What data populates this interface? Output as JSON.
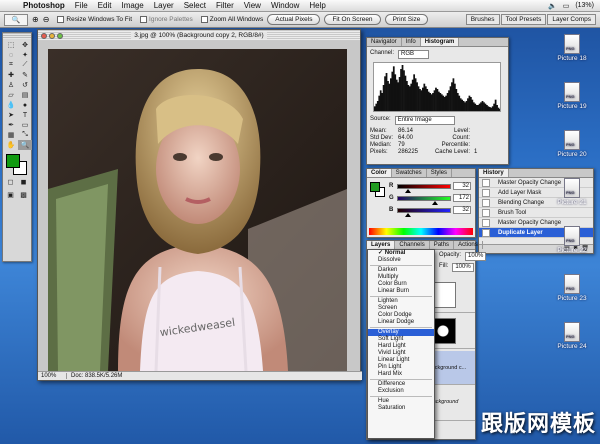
{
  "menubar": {
    "app": "Photoshop",
    "menus": [
      "File",
      "Edit",
      "Image",
      "Layer",
      "Select",
      "Filter",
      "View",
      "Window",
      "Help"
    ],
    "battery": "(13%)"
  },
  "options": {
    "resize_windows": "Resize Windows To Fit",
    "ignore_palettes": "Ignore Palettes",
    "zoom_all": "Zoom All Windows",
    "actual_pixels": "Actual Pixels",
    "fit_on_screen": "Fit On Screen",
    "print_size": "Print Size",
    "well_tabs": [
      "Brushes",
      "Tool Presets",
      "Layer Comps"
    ]
  },
  "document": {
    "title": "3.jpg @ 100% (Background copy 2, RGB/8#)",
    "zoom": "100%",
    "doc_size": "Doc: 838.5K/5.26M",
    "shirt_text": "wickedweasel"
  },
  "histogram": {
    "tabs": [
      "Navigator",
      "Info",
      "Histogram"
    ],
    "channel_label": "Channel:",
    "channel": "RGB",
    "source_label": "Source:",
    "source": "Entire Image",
    "stats": [
      {
        "k": "Mean:",
        "v": "86.14",
        "k2": "Level:",
        "v2": ""
      },
      {
        "k": "Std Dev:",
        "v": "64.00",
        "k2": "Count:",
        "v2": ""
      },
      {
        "k": "Median:",
        "v": "79",
        "k2": "Percentile:",
        "v2": ""
      },
      {
        "k": "Pixels:",
        "v": "286225",
        "k2": "Cache Level:",
        "v2": "1"
      }
    ],
    "values": [
      10,
      14,
      18,
      26,
      34,
      30,
      42,
      55,
      60,
      48,
      44,
      52,
      62,
      70,
      58,
      50,
      46,
      54,
      66,
      72,
      64,
      56,
      48,
      42,
      40,
      44,
      50,
      58,
      52,
      46,
      40,
      36,
      34,
      38,
      44,
      40,
      36,
      32,
      30,
      28,
      30,
      34,
      38,
      36,
      32,
      30,
      28,
      26,
      24,
      26,
      30,
      34,
      40,
      46,
      52,
      44,
      36,
      30,
      26,
      22,
      20,
      18,
      16,
      18,
      22,
      26,
      24,
      20,
      16,
      14,
      12,
      12,
      14,
      16,
      18,
      16,
      14,
      12,
      10,
      9,
      8,
      10,
      14,
      20,
      12,
      8,
      6,
      5
    ]
  },
  "color": {
    "tabs": [
      "Color",
      "Swatches",
      "Styles"
    ],
    "channels": [
      {
        "label": "R",
        "value": "32",
        "pos": 0.13
      },
      {
        "label": "G",
        "value": "172",
        "pos": 0.67
      },
      {
        "label": "B",
        "value": "32",
        "pos": 0.13
      }
    ]
  },
  "history": {
    "tabs": [
      "History"
    ],
    "items": [
      "Master Opacity Change",
      "Add Layer Mask",
      "Blending Change",
      "Brush Tool",
      "Master Opacity Change",
      "Duplicate Layer"
    ]
  },
  "layers": {
    "tabs": [
      "Layers",
      "Channels",
      "Paths",
      "Actions"
    ],
    "opacity_label": "Opacity:",
    "opacity": "100%",
    "fill_label": "Fill:",
    "fill": "100%",
    "layer_names": [
      "Background c...",
      "Background"
    ]
  },
  "blend_modes": {
    "groups": [
      [
        "Normal",
        "Dissolve"
      ],
      [
        "Darken",
        "Multiply",
        "Color Burn",
        "Linear Burn"
      ],
      [
        "Lighten",
        "Screen",
        "Color Dodge",
        "Linear Dodge"
      ],
      [
        "Overlay",
        "Soft Light",
        "Hard Light",
        "Vivid Light",
        "Linear Light",
        "Pin Light",
        "Hard Mix"
      ],
      [
        "Difference",
        "Exclusion"
      ],
      [
        "Hue",
        "Saturation"
      ]
    ],
    "selected": "Overlay",
    "current": "Normal"
  },
  "desktop_icons": [
    "Picture 18",
    "Picture 19",
    "Picture 20",
    "Picture 21",
    "Picture 22",
    "Picture 23",
    "Picture 24"
  ],
  "watermark": "跟版网模板"
}
